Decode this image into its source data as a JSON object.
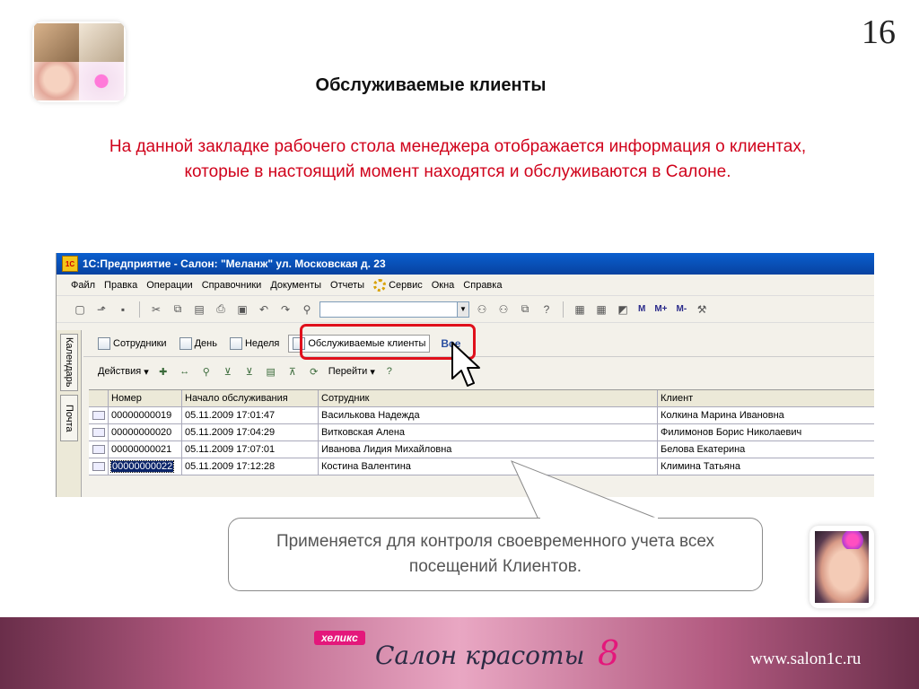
{
  "slide": {
    "page_number": "16",
    "title": "Обслуживаемые клиенты",
    "description": "На данной закладке рабочего стола менеджера отображается информация о клиентах, которые в настоящий момент находятся и обслуживаются в Салоне.",
    "callout": "Применяется для контроля своевременного учета всех посещений Клиентов.",
    "footer": {
      "brand_badge": "хеликс",
      "brand_name": "Салон красоты",
      "brand_version": "8",
      "url": "www.salon1c.ru"
    },
    "colors": {
      "accent": "#d0021b",
      "highlight": "#e0101c",
      "brand_pink": "#e4177b"
    }
  },
  "window": {
    "app_icon": "1С",
    "title": "1С:Предприятие - Салон: \"Меланж\" ул. Московская д. 23",
    "menu": [
      "Файл",
      "Правка",
      "Операции",
      "Справочники",
      "Документы",
      "Отчеты",
      "Сервис",
      "Окна",
      "Справка"
    ],
    "memory_buttons": [
      "M",
      "M+",
      "M-"
    ],
    "side_tabs": [
      "Календарь",
      "Почта"
    ],
    "view_tabs": [
      "Сотрудники",
      "День",
      "Неделя",
      "Обслуживаемые клиенты"
    ],
    "view_all": "Все",
    "actions": {
      "actions_label": "Действия",
      "goto_label": "Перейти"
    },
    "table": {
      "columns": [
        "Номер",
        "Начало обслуживания",
        "Сотрудник",
        "Клиент"
      ],
      "rows": [
        {
          "number": "00000000019",
          "start": "05.11.2009 17:01:47",
          "employee": "Василькова Надежда",
          "client": "Колкина Марина Ивановна"
        },
        {
          "number": "00000000020",
          "start": "05.11.2009 17:04:29",
          "employee": "Витковская Алена",
          "client": "Филимонов Борис Николаевич"
        },
        {
          "number": "00000000021",
          "start": "05.11.2009 17:07:01",
          "employee": "Иванова Лидия Михайловна",
          "client": "Белова Екатерина"
        },
        {
          "number": "00000000022",
          "start": "05.11.2009 17:12:28",
          "employee": "Костина Валентина",
          "client": "Климина Татьяна"
        }
      ]
    }
  }
}
